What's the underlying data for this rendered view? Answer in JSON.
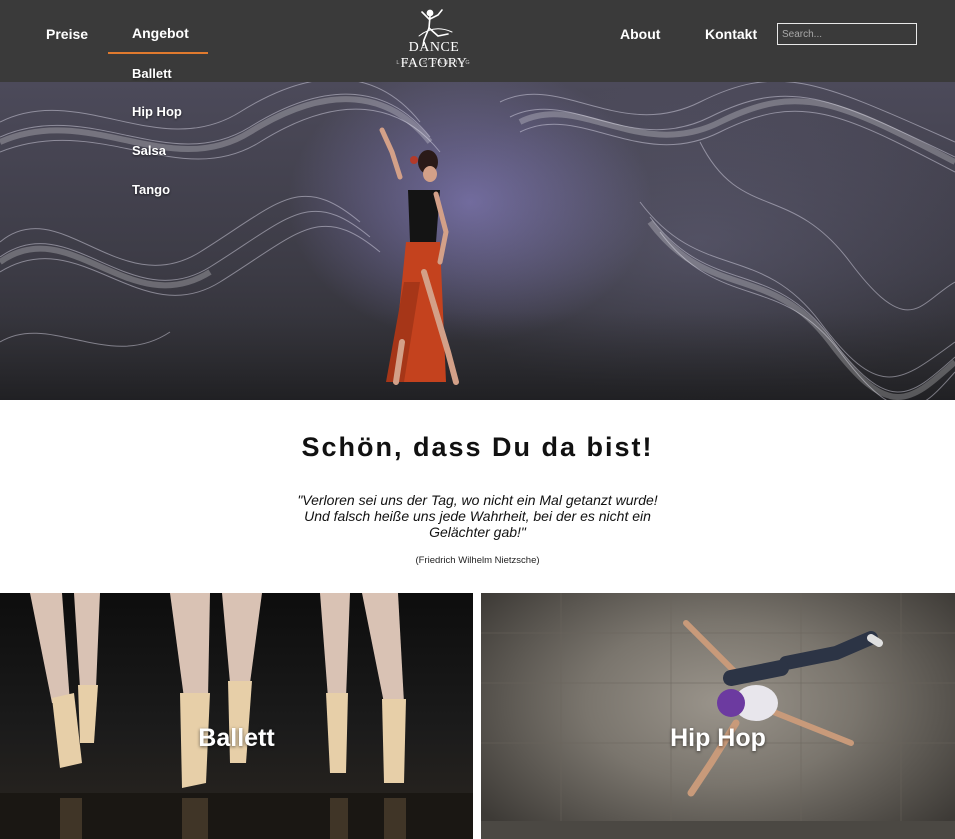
{
  "nav": {
    "preise": "Preise",
    "angebot": "Angebot",
    "about": "About",
    "kontakt": "Kontakt",
    "search_placeholder": "Search...",
    "accent": "#e07a2e"
  },
  "logo": {
    "name": "DANCE FACTORY",
    "tagline": "LIFE IS DANCING"
  },
  "dropdown": {
    "items": [
      "Ballett",
      "Hip Hop",
      "Salsa",
      "Tango"
    ]
  },
  "welcome": {
    "title": "Schön, dass Du da bist!",
    "quote": "\"Verloren sei uns der Tag, wo nicht ein Mal getanzt wurde! Und falsch heiße uns jede Wahrheit, bei der es nicht ein Gelächter gab!\"",
    "author": "(Friedrich Wilhelm Nietzsche)"
  },
  "cards": [
    {
      "label": "Ballett"
    },
    {
      "label": "Hip Hop"
    }
  ],
  "colors": {
    "header_bg": "#3a3a3a",
    "page_bg": "#ffffff"
  }
}
